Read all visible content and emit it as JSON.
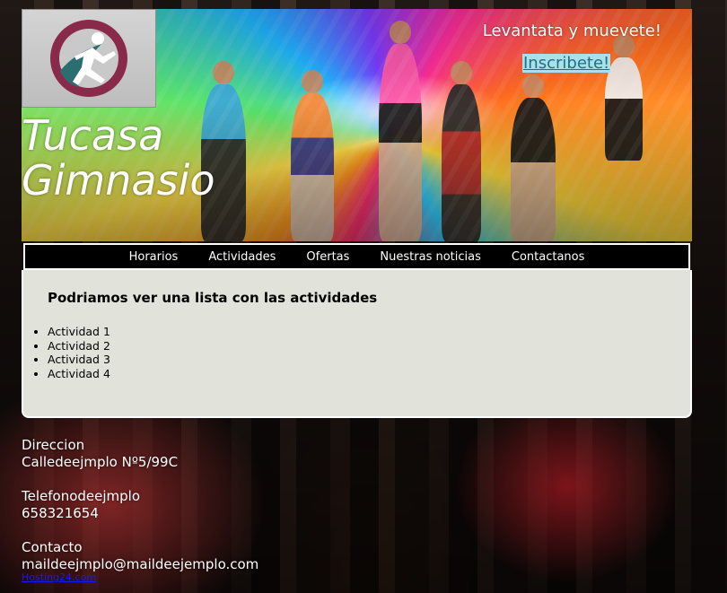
{
  "header": {
    "brand_line1": "Tucasa",
    "brand_line2": "Gimnasio",
    "slogan": "Levantata y muevete!",
    "signup_link": "Inscribete!",
    "logo": "runner-logo-icon"
  },
  "nav": {
    "items": [
      {
        "label": "Horarios"
      },
      {
        "label": "Actividades"
      },
      {
        "label": "Ofertas"
      },
      {
        "label": "Nuestras noticias"
      },
      {
        "label": "Contactanos"
      }
    ]
  },
  "main": {
    "heading": "Podriamos ver una lista con las actividades",
    "activities": [
      "Actividad 1",
      "Actividad 2",
      "Actividad 3",
      "Actividad 4"
    ]
  },
  "footer": {
    "address_label": "Direccion",
    "address_value": "Calledeejmplo Nº5/99C",
    "phone_label": "Telefonodeejmplo",
    "phone_value": "658321654",
    "contact_label": "Contacto",
    "contact_value": "maildeejmplo@maildeejemplo.com",
    "hosting_link": "Hosting24.com"
  },
  "colors": {
    "nav_bg": "#000000",
    "main_bg": "#e1e2da",
    "signup_bg": "#a9e0ea",
    "signup_text": "#1f6f86",
    "logo_ring": "#8a2a4a",
    "logo_inner": "#2a6e72"
  }
}
